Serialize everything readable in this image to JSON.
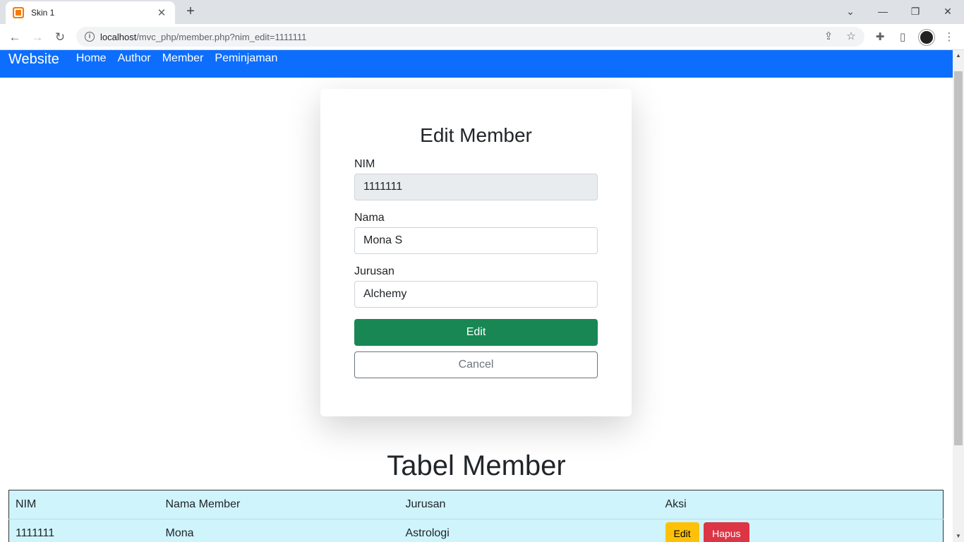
{
  "browser": {
    "tab_title": "Skin 1",
    "url_host": "localhost",
    "url_path": "/mvc_php/member.php?nim_edit=1111111"
  },
  "navbar": {
    "brand": "Website",
    "links": [
      "Home",
      "Author",
      "Member",
      "Peminjaman"
    ]
  },
  "form": {
    "title": "Edit Member",
    "nim_label": "NIM",
    "nim_value": "1111111",
    "nama_label": "Nama",
    "nama_value": "Mona S",
    "jurusan_label": "Jurusan",
    "jurusan_value": "Alchemy",
    "submit_label": "Edit",
    "cancel_label": "Cancel"
  },
  "table": {
    "title": "Tabel Member",
    "headers": [
      "NIM",
      "Nama Member",
      "Jurusan",
      "Aksi"
    ],
    "rows": [
      {
        "nim": "1111111",
        "nama": "Mona",
        "jurusan": "Astrologi",
        "edit_label": "Edit",
        "hapus_label": "Hapus"
      }
    ]
  },
  "colors": {
    "navbar": "#0d6efd",
    "success": "#198754",
    "warning": "#ffc107",
    "danger": "#dc3545",
    "table_bg": "#cff4fc"
  }
}
